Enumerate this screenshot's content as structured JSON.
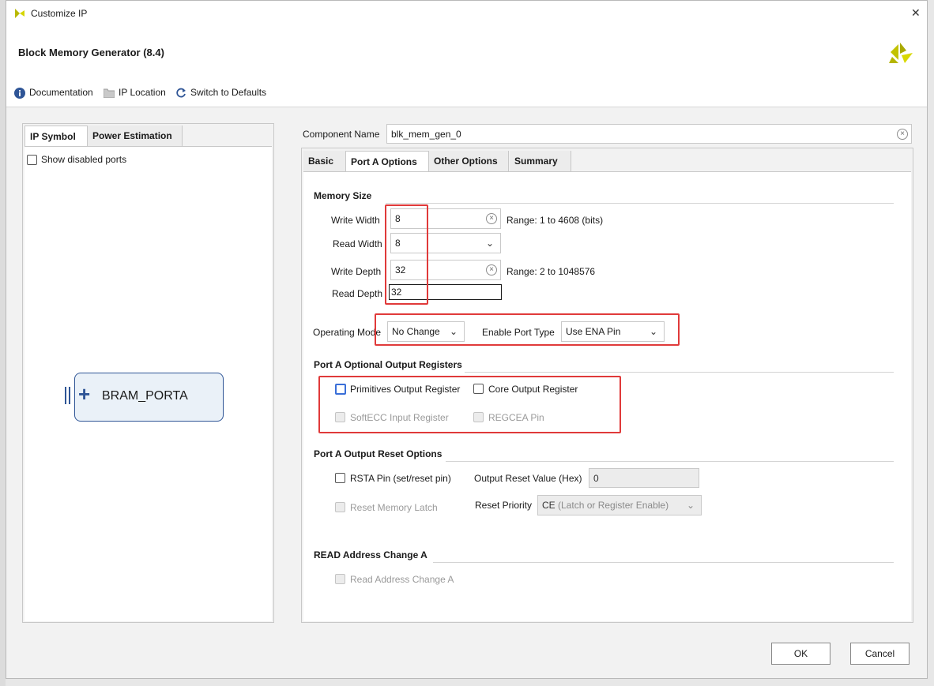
{
  "window": {
    "title": "Customize IP",
    "close_glyph": "✕"
  },
  "header": {
    "title": "Block Memory Generator (8.4)"
  },
  "toolbar": {
    "documentation": "Documentation",
    "ip_location": "IP Location",
    "switch_defaults": "Switch to Defaults"
  },
  "left_panel": {
    "tabs": [
      "IP Symbol",
      "Power Estimation"
    ],
    "show_disabled_ports": "Show disabled ports",
    "block_label": "BRAM_PORTA",
    "plus": "+"
  },
  "component": {
    "label": "Component Name",
    "value": "blk_mem_gen_0"
  },
  "tabs": [
    "Basic",
    "Port A Options",
    "Other Options",
    "Summary"
  ],
  "memory_size": {
    "title": "Memory Size",
    "write_width_label": "Write Width",
    "write_width": "8",
    "write_width_range": "Range: 1 to 4608 (bits)",
    "read_width_label": "Read Width",
    "read_width": "8",
    "write_depth_label": "Write Depth",
    "write_depth": "32",
    "write_depth_range": "Range: 2 to 1048576",
    "read_depth_label": "Read Depth",
    "read_depth": "32"
  },
  "mode": {
    "operating_mode_label": "Operating Mode",
    "operating_mode": "No Change",
    "enable_port_type_label": "Enable Port Type",
    "enable_port_type": "Use ENA Pin"
  },
  "output_registers": {
    "title": "Port A Optional Output Registers",
    "primitives": "Primitives Output Register",
    "core": "Core Output Register",
    "softecc": "SoftECC Input Register",
    "regcea": "REGCEA Pin"
  },
  "reset_options": {
    "title": "Port A Output Reset Options",
    "rsta": "RSTA Pin (set/reset pin)",
    "reset_value_label": "Output Reset Value (Hex)",
    "reset_value": "0",
    "reset_memory_latch": "Reset Memory Latch",
    "reset_priority_label": "Reset Priority",
    "reset_priority_main": "CE",
    "reset_priority_detail": "(Latch or Register Enable)"
  },
  "read_address": {
    "title": "READ Address Change A",
    "checkbox": "Read Address Change A"
  },
  "buttons": {
    "ok": "OK",
    "cancel": "Cancel"
  },
  "colors": {
    "highlight": "#e03a3a",
    "brand_yellow": "#c8c800",
    "accent_blue": "#3a6fd8"
  }
}
